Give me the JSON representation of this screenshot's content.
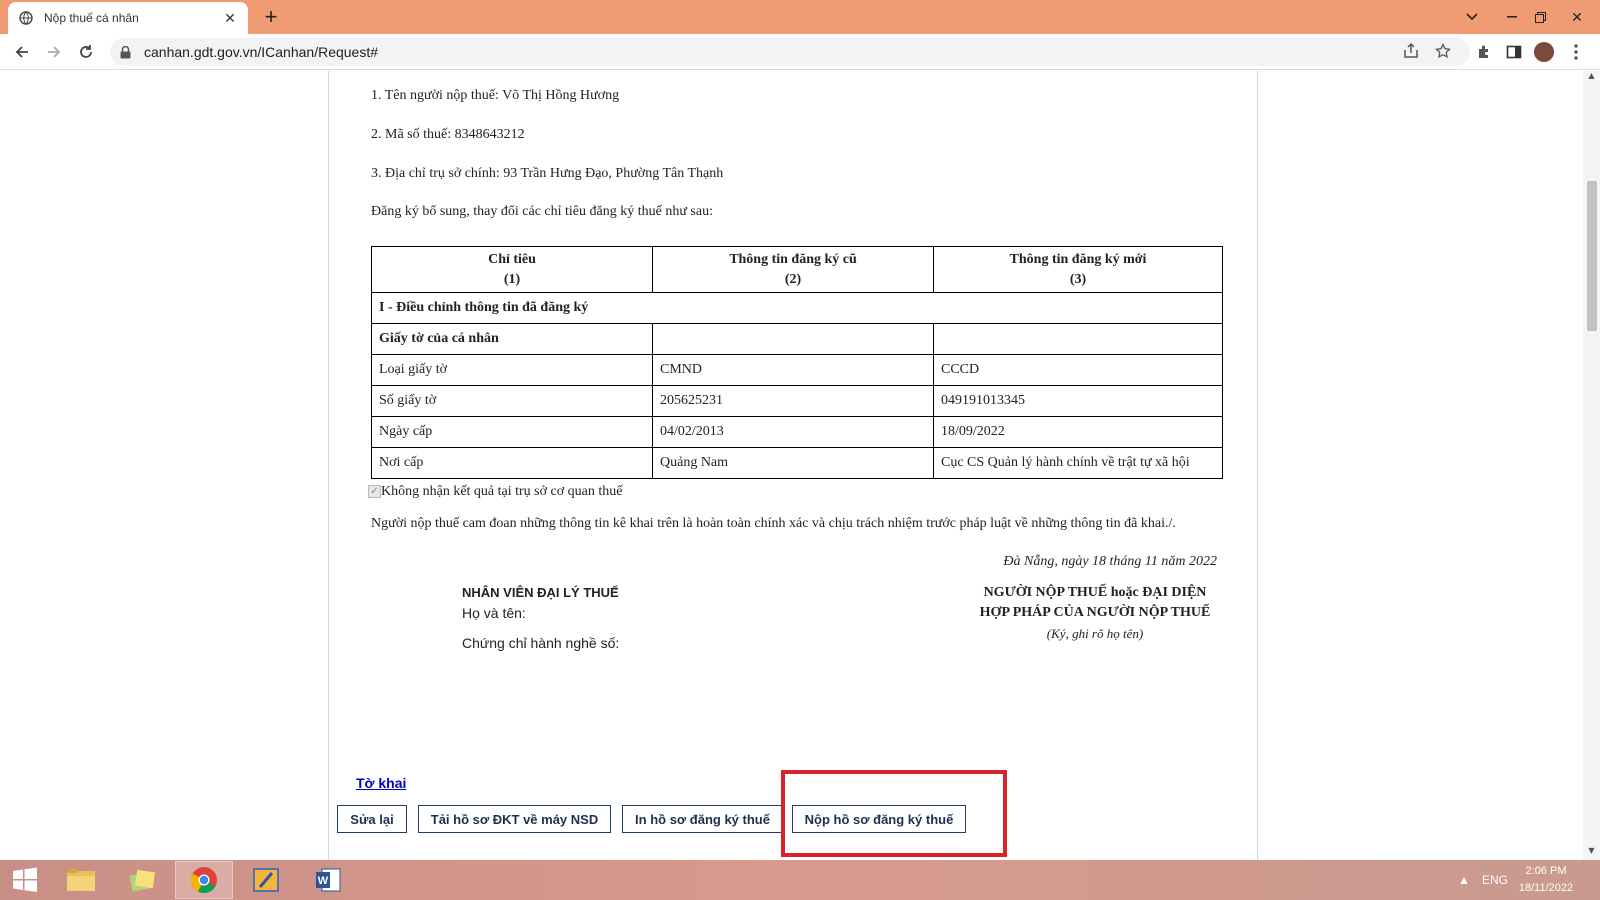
{
  "browser": {
    "tab_title": "Nộp thuế cá nhân",
    "url": "canhan.gdt.gov.vn/ICanhan/Request#"
  },
  "form": {
    "line1": "1. Tên người nộp thuế: Võ Thị Hồng Hương",
    "line2": "2. Mã số thuế: 8348643212",
    "line3": "3. Địa chỉ trụ sở chính: 93 Trần Hưng Đạo, Phường Tân Thạnh",
    "intro": "Đăng ký bổ sung, thay đổi các chỉ tiêu đăng ký thuế như sau:",
    "table": {
      "headers": [
        {
          "label": "Chỉ tiêu",
          "num": "(1)"
        },
        {
          "label": "Thông tin đăng ký cũ",
          "num": "(2)"
        },
        {
          "label": "Thông tin đăng ký mới",
          "num": "(3)"
        }
      ],
      "section": "I - Điều chỉnh thông tin đã đăng ký",
      "group": "Giấy tờ của cá nhân",
      "rows": [
        [
          "Loại giấy tờ",
          "CMND",
          "CCCD"
        ],
        [
          "Số giấy tờ",
          "205625231",
          "049191013345"
        ],
        [
          "Ngày cấp",
          "04/02/2013",
          "18/09/2022"
        ],
        [
          "Nơi cấp",
          "Quảng Nam",
          "Cục CS Quản lý hành chính về trật tự xã hội"
        ]
      ]
    },
    "checkbox_label": "Không nhận kết quả tại trụ sở cơ quan thuế",
    "declaration": "Người nộp thuế cam đoan những thông tin kê khai trên là hoàn toàn chính xác và chịu trách nhiệm trước pháp luật về những thông tin đã khai./.",
    "date_line": "Đà Nẵng, ngày 18 tháng 11 năm 2022",
    "agent_title": "NHÂN VIÊN ĐẠI LÝ THUẾ",
    "agent_name_label": "Họ và tên:",
    "agent_cert_label": "Chứng chỉ hành nghề số:",
    "taxpayer_title_1": "NGƯỜI NỘP THUẾ hoặc ĐẠI DIỆN",
    "taxpayer_title_2": "HỢP PHÁP CỦA NGƯỜI NỘP THUẾ",
    "taxpayer_sign": "(Ký, ghi rõ họ tên)",
    "link_to_khai": "Tờ khai"
  },
  "buttons": {
    "edit": "Sửa lại",
    "download": "Tải hồ sơ ĐKT về máy NSD",
    "print": "In hồ sơ đăng ký thuế",
    "submit": "Nộp hồ sơ đăng ký thuế"
  },
  "taskbar": {
    "lang": "ENG",
    "time": "2:06 PM",
    "date": "18/11/2022"
  },
  "colors": {
    "tabbar": "#ef9c74",
    "highlight": "#d9232a",
    "link": "#0000cc"
  }
}
